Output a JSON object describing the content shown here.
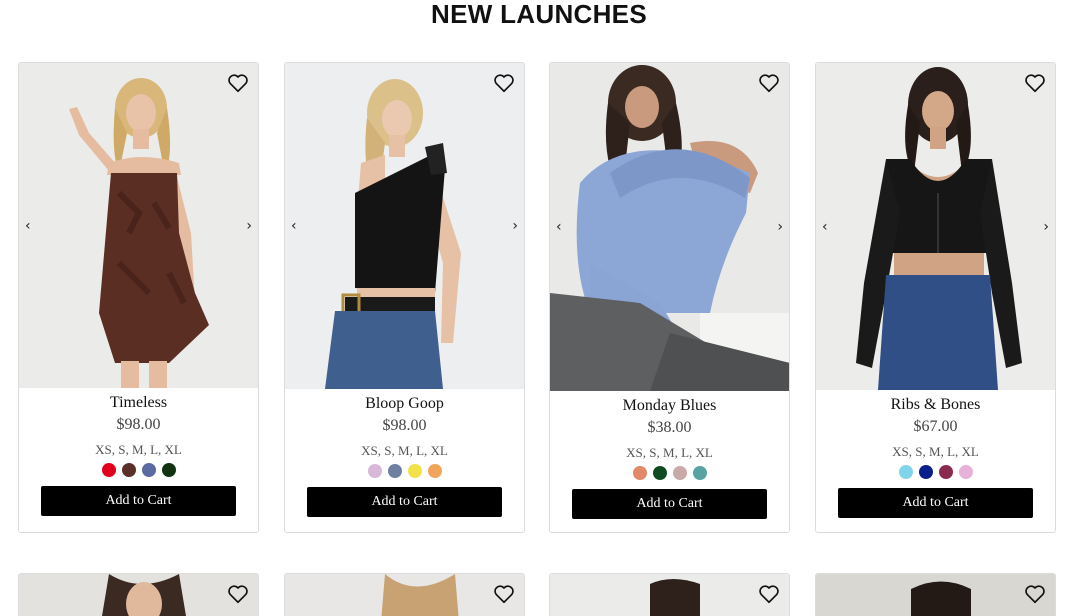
{
  "section": {
    "title": "NEW LAUNCHES"
  },
  "nav": {
    "prev": "‹",
    "next": "›"
  },
  "products": [
    {
      "name": "Timeless",
      "price": "$98.00",
      "sizes": "XS, S, M, L, XL",
      "swatches": [
        "#e0001b",
        "#5a3028",
        "#5b6aa3",
        "#103412"
      ],
      "cta": "Add to Cart"
    },
    {
      "name": "Bloop Goop",
      "price": "$98.00",
      "sizes": "XS, S, M, L, XL",
      "swatches": [
        "#d8b8d8",
        "#6f7f9f",
        "#f2e24a",
        "#f0a55a"
      ],
      "cta": "Add to Cart"
    },
    {
      "name": "Monday Blues",
      "price": "$38.00",
      "sizes": "XS, S, M, L, XL",
      "swatches": [
        "#e2896a",
        "#0f4a22",
        "#c9a8a8",
        "#5aa3a3"
      ],
      "cta": "Add to Cart"
    },
    {
      "name": "Ribs & Bones",
      "price": "$67.00",
      "sizes": "XS, S, M, L, XL",
      "swatches": [
        "#7fd6ea",
        "#0b1f8a",
        "#8a2b4e",
        "#e8b2d8"
      ],
      "cta": "Add to Cart"
    }
  ]
}
